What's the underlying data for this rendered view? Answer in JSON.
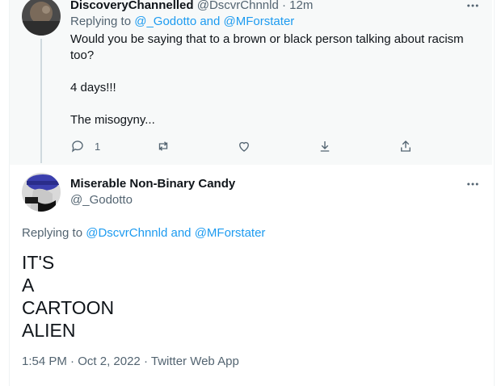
{
  "reply_tweet": {
    "author_name": "DiscoveryChannelled",
    "author_handle": "@DscvrChnnld",
    "time_ago": "12m",
    "replying_prefix": "Replying to",
    "replying_user1": "@_Godotto",
    "replying_and": "and",
    "replying_user2": "@MForstater",
    "text": "Would you be saying that to a brown or black person talking about racism too?\n\n4 days!!!\n\nThe misogyny...",
    "reply_count": "1",
    "more_icon": "more-icon"
  },
  "main_tweet": {
    "author_name": "Miserable Non-Binary Candy",
    "author_handle": "@_Godotto",
    "replying_prefix": "Replying to",
    "replying_user1": "@DscvrChnnld",
    "replying_and": "and",
    "replying_user2": "@MForstater",
    "text": "IT'S\nA\nCARTOON\nALIEN",
    "time": "1:54 PM",
    "date": "Oct 2, 2022",
    "source": "Twitter Web App"
  },
  "colors": {
    "accent": "#1d9bf0",
    "muted": "#536471",
    "text": "#0f1419",
    "highlight_bg": "#f7f9f9"
  }
}
